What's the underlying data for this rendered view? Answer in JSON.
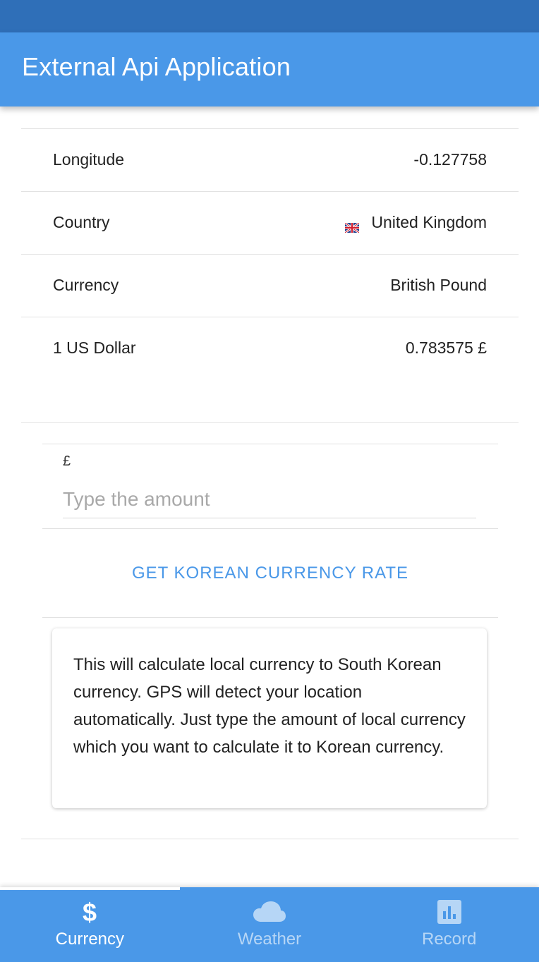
{
  "app_bar": {
    "title": "External Api Application"
  },
  "info_rows": [
    {
      "label": "Longitude",
      "value": "-0.127758"
    },
    {
      "label": "Country",
      "value": "United Kingdom",
      "icon": "uk-flag-icon"
    },
    {
      "label": "Currency",
      "value": "British Pound"
    },
    {
      "label": "1 US Dollar",
      "value": "0.783575 £"
    }
  ],
  "amount_field": {
    "symbol": "£",
    "placeholder": "Type the amount",
    "value": ""
  },
  "korean_button": {
    "label": "GET KOREAN CURRENCY RATE"
  },
  "info_card": {
    "text": "This will calculate local currency to South Korean currency. GPS will detect your location automatically. Just type the amount of local currency which you want to calculate it to Korean currency."
  },
  "tabs": [
    {
      "label": "Currency",
      "icon": "dollar-icon",
      "active": true
    },
    {
      "label": "Weather",
      "icon": "cloud-icon",
      "active": false
    },
    {
      "label": "Record",
      "icon": "bar-chart-icon",
      "active": false
    }
  ],
  "colors": {
    "accent": "#4a98e8",
    "status_bar": "#2f6fb8"
  }
}
